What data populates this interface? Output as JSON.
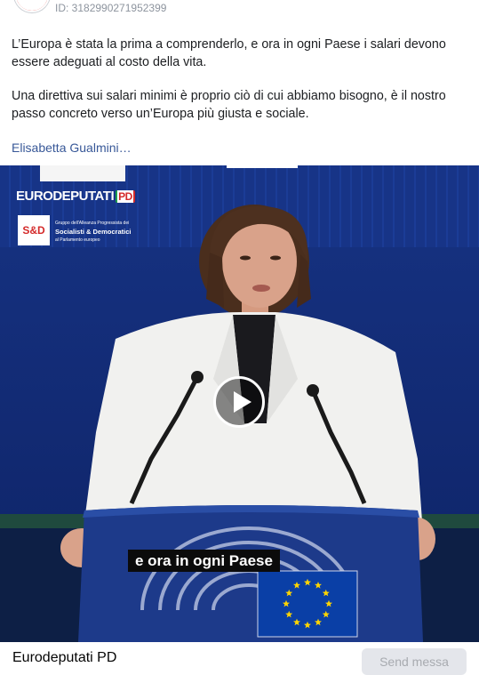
{
  "post": {
    "id_label": "ID: 3182990271952399",
    "paragraph_1": "L’Europa è stata la prima a comprenderlo, e ora in ogni Paese i salari devono essere adeguati al costo della vita.",
    "paragraph_2": "Una direttiva sui salari minimi è proprio ciò di cui abbiamo bisogno, è il nostro passo concreto verso un’Europa più giusta e sociale.",
    "see_more_label": "Elisabetta Gualmini…"
  },
  "video": {
    "brand": "EURODEPUTATI",
    "brand_suffix": "PD",
    "sd_badge": "S&D",
    "sd_line_1": "Gruppo dell'Alleanza Progressista dei",
    "sd_line_2": "Socialisti & Democratici",
    "sd_line_3": "al Parlamento europeo",
    "subtitle": "e ora in ogni Paese"
  },
  "footer": {
    "page_name": "Eurodeputati PD",
    "send_label": "Send messa"
  },
  "colors": {
    "link": "#385898",
    "background": "#ffffff",
    "video_wall": "#10246a",
    "eu_flag": "#0a3fa6",
    "eu_stars": "#ffd500"
  }
}
